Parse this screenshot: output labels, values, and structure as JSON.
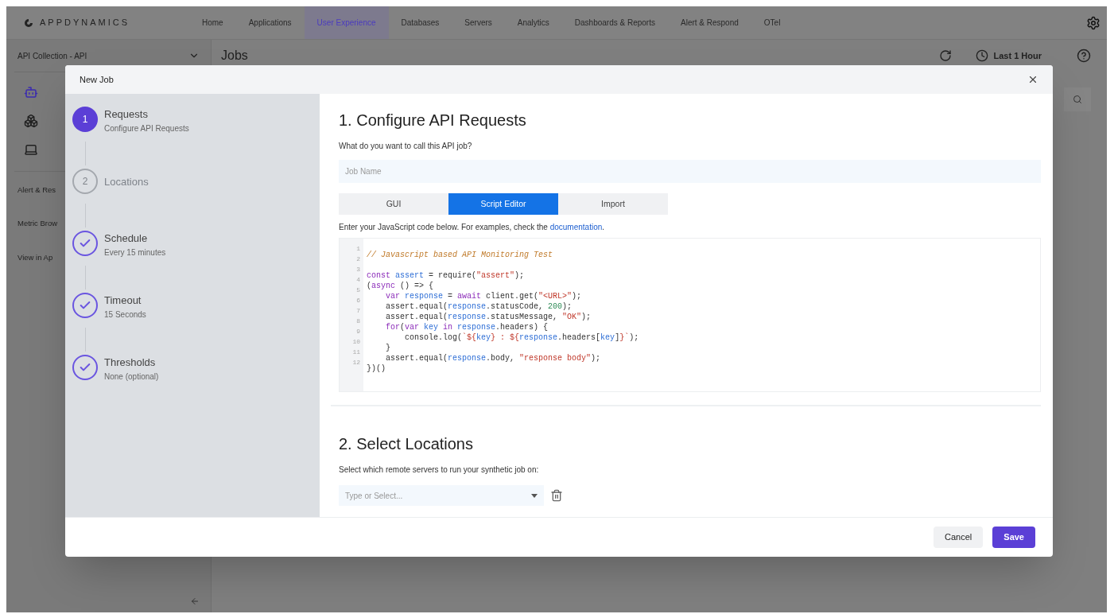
{
  "brand": {
    "name": "APPDYNAMICS"
  },
  "nav": [
    {
      "label": "Home",
      "selected": false
    },
    {
      "label": "Applications",
      "selected": false
    },
    {
      "label": "User Experience",
      "selected": true
    },
    {
      "label": "Databases",
      "selected": false
    },
    {
      "label": "Servers",
      "selected": false
    },
    {
      "label": "Analytics",
      "selected": false
    },
    {
      "label": "Dashboards & Reports",
      "selected": false
    },
    {
      "label": "Alert & Respond",
      "selected": false
    },
    {
      "label": "OTel",
      "selected": false
    }
  ],
  "sidebar": {
    "collection": "API Collection - API",
    "links": [
      "Alert & Res",
      "Metric Brow",
      "View in Ap"
    ]
  },
  "page": {
    "title": "Jobs",
    "time_range": "Last 1 Hour"
  },
  "modal": {
    "title": "New Job",
    "steps": [
      {
        "kind": "active",
        "number": "1",
        "title": "Requests",
        "subtitle": "Configure API Requests"
      },
      {
        "kind": "pending",
        "number": "2",
        "title": "Locations"
      },
      {
        "kind": "done",
        "title": "Schedule",
        "subtitle": "Every 15 minutes"
      },
      {
        "kind": "done",
        "title": "Timeout",
        "subtitle": "15 Seconds"
      },
      {
        "kind": "done",
        "title": "Thresholds",
        "subtitle": "None (optional)"
      }
    ],
    "section1": {
      "heading": "1. Configure API Requests",
      "question": "What do you want to call this API job?",
      "job_name": {
        "placeholder": "Job Name"
      },
      "tabs": [
        {
          "label": "GUI",
          "selected": false
        },
        {
          "label": "Script Editor",
          "selected": true
        },
        {
          "label": "Import",
          "selected": false
        }
      ],
      "hint": "Enter your JavaScript code below. For examples, check the ",
      "hint_link": "documentation",
      "hint_end": ".",
      "code": [
        {
          "number": "1",
          "tokens": [
            {
              "kind": "comment",
              "text": "// Javascript based API Monitoring Test"
            }
          ]
        },
        {
          "number": "2"
        },
        {
          "number": "3",
          "tokens": [
            {
              "kind": "keyword",
              "text": "const"
            },
            {
              "kind": "variable",
              "text": " assert"
            },
            {
              "kind": "plain",
              "text": " = require("
            },
            {
              "kind": "string",
              "text": "\"assert\""
            },
            {
              "kind": "plain",
              "text": ");"
            }
          ]
        },
        {
          "number": "4",
          "tokens": [
            {
              "kind": "plain",
              "text": "("
            },
            {
              "kind": "keyword",
              "text": "async"
            },
            {
              "kind": "plain",
              "text": " () => {"
            }
          ]
        },
        {
          "number": "5",
          "tokens": [
            {
              "kind": "keyword",
              "text": "    var"
            },
            {
              "kind": "variable",
              "text": " response"
            },
            {
              "kind": "plain",
              "text": " = "
            },
            {
              "kind": "keyword",
              "text": "await"
            },
            {
              "kind": "plain",
              "text": " client.get("
            },
            {
              "kind": "string",
              "text": "\"<URL>\""
            },
            {
              "kind": "plain",
              "text": ");"
            }
          ]
        },
        {
          "number": "6",
          "tokens": [
            {
              "kind": "plain",
              "text": "    assert.equal("
            },
            {
              "kind": "variable",
              "text": "response"
            },
            {
              "kind": "plain",
              "text": ".statusCode, "
            },
            {
              "kind": "number",
              "text": "200"
            },
            {
              "kind": "plain",
              "text": ");"
            }
          ]
        },
        {
          "number": "7",
          "tokens": [
            {
              "kind": "plain",
              "text": "    assert.equal("
            },
            {
              "kind": "variable",
              "text": "response"
            },
            {
              "kind": "plain",
              "text": ".statusMessage, "
            },
            {
              "kind": "string",
              "text": "\"OK\""
            },
            {
              "kind": "plain",
              "text": ");"
            }
          ]
        },
        {
          "number": "8",
          "tokens": [
            {
              "kind": "keyword",
              "text": "    for"
            },
            {
              "kind": "plain",
              "text": "("
            },
            {
              "kind": "keyword",
              "text": "var"
            },
            {
              "kind": "variable",
              "text": " key"
            },
            {
              "kind": "keyword",
              "text": " in"
            },
            {
              "kind": "variable",
              "text": " response"
            },
            {
              "kind": "plain",
              "text": ".headers) {"
            }
          ]
        },
        {
          "number": "9",
          "tokens": [
            {
              "kind": "plain",
              "text": "        console.log("
            },
            {
              "kind": "string",
              "text": "`${"
            },
            {
              "kind": "variable",
              "text": "key"
            },
            {
              "kind": "string",
              "text": "} : ${"
            },
            {
              "kind": "variable",
              "text": "response"
            },
            {
              "kind": "plain",
              "text": ".headers["
            },
            {
              "kind": "variable",
              "text": "key"
            },
            {
              "kind": "plain",
              "text": "]"
            },
            {
              "kind": "string",
              "text": "}`"
            },
            {
              "kind": "plain",
              "text": ");"
            }
          ]
        },
        {
          "number": "10",
          "tokens": [
            {
              "kind": "plain",
              "text": "    }"
            }
          ]
        },
        {
          "number": "11",
          "tokens": [
            {
              "kind": "plain",
              "text": "    assert.equal("
            },
            {
              "kind": "variable",
              "text": "response"
            },
            {
              "kind": "plain",
              "text": ".body, "
            },
            {
              "kind": "string",
              "text": "\"response body\""
            },
            {
              "kind": "plain",
              "text": ");"
            }
          ]
        },
        {
          "number": "12",
          "tokens": [
            {
              "kind": "plain",
              "text": "})()"
            }
          ]
        }
      ]
    },
    "section2": {
      "heading": "2. Select Locations",
      "description": "Select which remote servers to run your synthetic job on:",
      "location": {
        "placeholder": "Type or Select..."
      }
    },
    "buttons": [
      {
        "kind": "secondary",
        "label": "Cancel"
      },
      {
        "kind": "primary",
        "label": "Save"
      }
    ]
  }
}
